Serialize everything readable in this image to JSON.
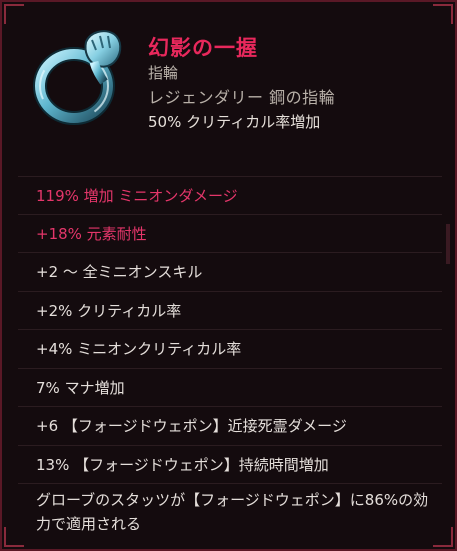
{
  "item": {
    "name": "幻影の一握",
    "type": "指輪",
    "rarity_line": "レジェンダリー 鋼の指輪",
    "implicit": "50% クリティカル率増加",
    "icon": "ring-icon"
  },
  "colors": {
    "legendary_name": "#e8285c",
    "greater_affix": "#e4366a",
    "normal_text": "#e4deda",
    "muted_text": "#b8b0a8",
    "border": "#5a1826"
  },
  "affixes": [
    {
      "text": "119% 増加 ミニオンダメージ",
      "greater": true
    },
    {
      "text": "+18% 元素耐性",
      "greater": true
    },
    {
      "text": "+2 〜 全ミニオンスキル",
      "greater": false
    },
    {
      "text": "+2% クリティカル率",
      "greater": false
    },
    {
      "text": "+4% ミニオンクリティカル率",
      "greater": false
    },
    {
      "text": "7% マナ増加",
      "greater": false
    },
    {
      "text": "+6 【フォージドウェポン】近接死霊ダメージ",
      "greater": false
    },
    {
      "text": "13% 【フォージドウェポン】持続時間増加",
      "greater": false
    },
    {
      "text": "グローブのスタッツが【フォージドウェポン】に86%の効力で適用される",
      "greater": false
    }
  ]
}
